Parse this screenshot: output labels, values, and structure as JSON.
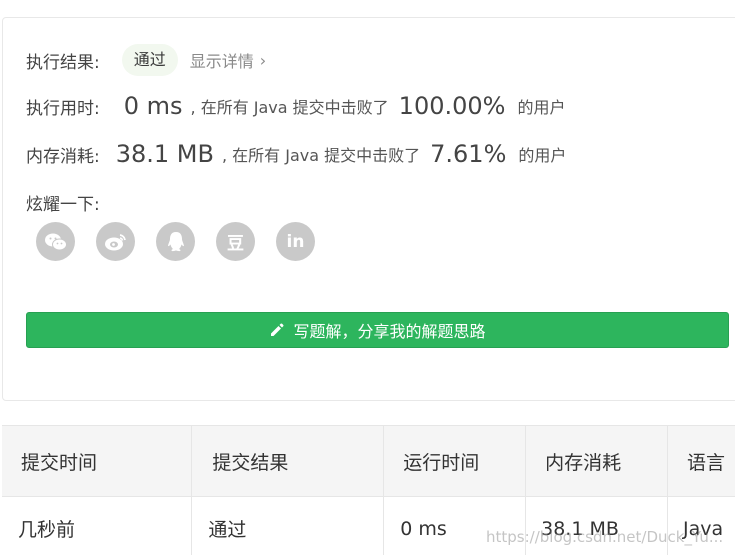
{
  "result": {
    "label": "执行结果:",
    "status": "通过",
    "detail_link": "显示详情",
    "detail_chevron": "›"
  },
  "runtime": {
    "label": "执行用时:",
    "value": "0 ms",
    "beat_text": ", 在所有 Java 提交中击败了",
    "percent": "100.00%",
    "suffix": "的用户"
  },
  "memory": {
    "label": "内存消耗:",
    "value": "38.1 MB",
    "beat_text": ", 在所有 Java 提交中击败了",
    "percent": "7.61%",
    "suffix": "的用户"
  },
  "share": {
    "label": "炫耀一下:",
    "icons": [
      "wechat-icon",
      "weibo-icon",
      "qq-icon",
      "douban-icon",
      "linkedin-icon"
    ],
    "douban_glyph": "豆",
    "linkedin_glyph": "in"
  },
  "write_button": {
    "label": "写题解，分享我的解题思路",
    "color": "#2db55d"
  },
  "submissions": {
    "headers": [
      "提交时间",
      "提交结果",
      "运行时间",
      "内存消耗",
      "语言"
    ],
    "rows": [
      {
        "time": "几秒前",
        "result": "通过",
        "runtime": "0 ms",
        "memory": "38.1 MB",
        "language": "Java"
      }
    ]
  },
  "watermark": "https://blog.csdn.net/Duck_Yu..."
}
